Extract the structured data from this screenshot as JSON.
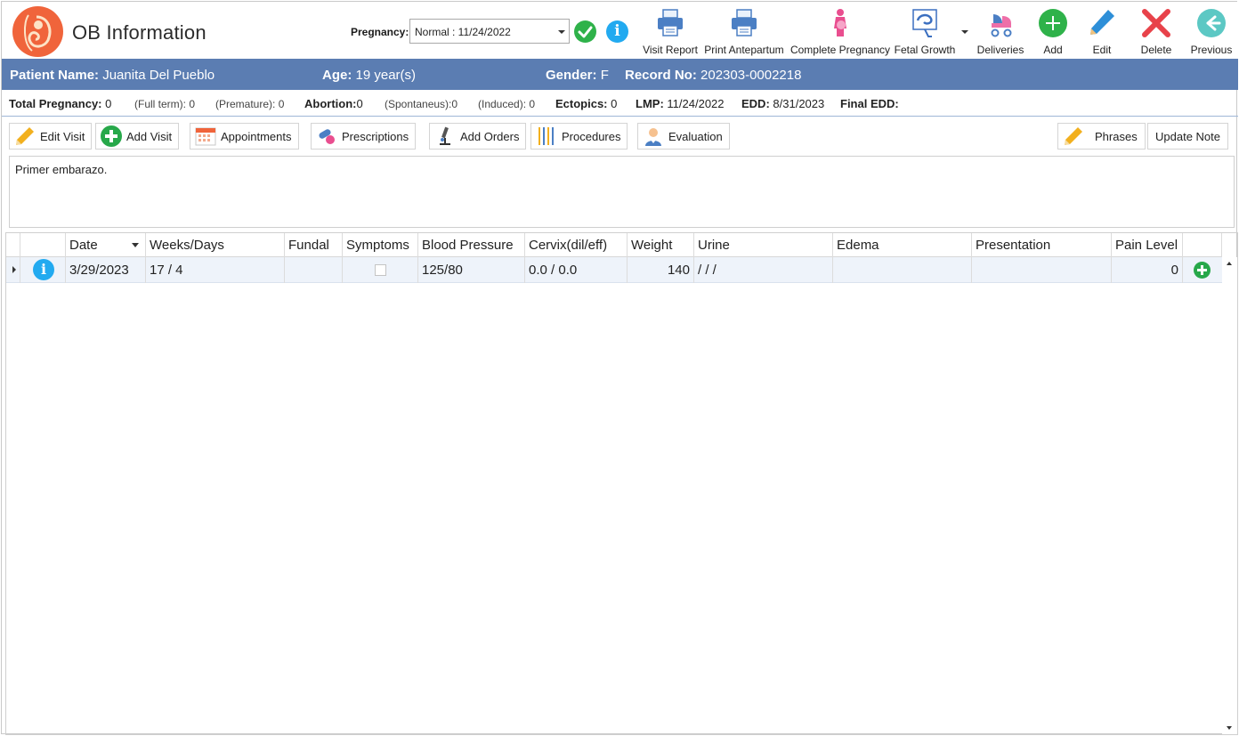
{
  "app": {
    "title": "OB Information"
  },
  "pregnancy": {
    "label": "Pregnancy:",
    "selected": "Normal : 11/24/2022"
  },
  "toolbar": {
    "visit_report": "Visit Report",
    "print_antepartum": "Print Antepartum",
    "complete_pregnancy": "Complete Pregnancy",
    "fetal_growth": "Fetal Growth",
    "deliveries": "Deliveries",
    "add": "Add",
    "edit": "Edit",
    "delete": "Delete",
    "previous": "Previous"
  },
  "patient": {
    "name_label": "Patient Name:",
    "name": "Juanita Del Pueblo",
    "age_label": "Age:",
    "age": "19 year(s)",
    "gender_label": "Gender:",
    "gender": "F",
    "record_label": "Record No:",
    "record": "202303-0002218"
  },
  "stats": {
    "total_label": "Total Pregnancy:",
    "total": "0",
    "fullterm_label": "(Full term):",
    "fullterm": "0",
    "premature_label": "(Premature):",
    "premature": "0",
    "abortion_label": "Abortion:",
    "abortion": "0",
    "spontaneus_label": "(Spontaneus):",
    "spontaneus": "0",
    "induced_label": "(Induced):",
    "induced": "0",
    "ectopics_label": "Ectopics:",
    "ectopics": "0",
    "lmp_label": "LMP:",
    "lmp": "11/24/2022",
    "edd_label": "EDD:",
    "edd": "8/31/2023",
    "final_edd_label": "Final EDD:",
    "final_edd": ""
  },
  "actions": {
    "edit_visit": "Edit Visit",
    "add_visit": "Add Visit",
    "appointments": "Appointments",
    "prescriptions": "Prescriptions",
    "add_orders": "Add Orders",
    "procedures": "Procedures",
    "evaluation": "Evaluation",
    "phrases": "Phrases",
    "update_note": "Update Note"
  },
  "note": {
    "text": "Primer embarazo."
  },
  "grid": {
    "columns": [
      "Date",
      "Weeks/Days",
      "Fundal",
      "Symptoms",
      "Blood Pressure",
      "Cervix(dil/eff)",
      "Weight",
      "Urine",
      "Edema",
      "Presentation",
      "Pain Level"
    ],
    "rows": [
      {
        "date": "3/29/2023",
        "weeks_days": "17 / 4",
        "fundal": "",
        "symptoms_checked": false,
        "blood_pressure": "125/80",
        "cervix": "0.0 / 0.0",
        "weight": "140",
        "urine": "/ / /",
        "edema": "",
        "presentation": "",
        "pain_level": "0"
      }
    ]
  },
  "colors": {
    "patient_bar": "#5b7db2",
    "accent_green": "#2fb24a",
    "info_blue": "#22aaf0",
    "delete_red": "#e8424a",
    "logo_orange": "#f0643b"
  }
}
